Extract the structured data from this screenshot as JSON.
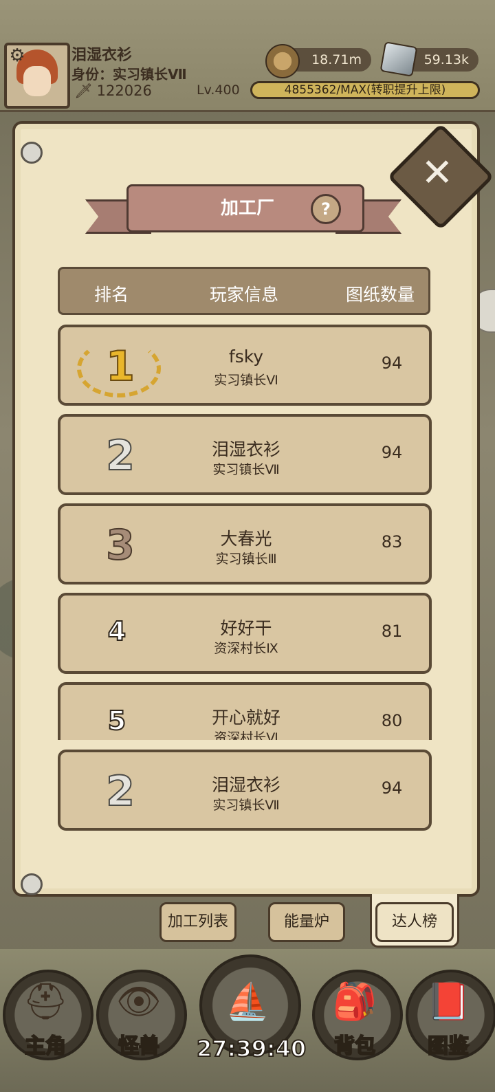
{
  "player": {
    "name": "泪湿衣衫",
    "title": "身份：实习镇长Ⅶ",
    "power": "122026",
    "level": "Lv.400",
    "exp_text": "4855362/MAX(转职提升上限)"
  },
  "resources": {
    "coins": "18.71m",
    "gems": "59.13k"
  },
  "panel": {
    "title": "加工厂",
    "headers": {
      "rank": "排名",
      "info": "玩家信息",
      "count": "图纸数量"
    }
  },
  "rankings": [
    {
      "rank": "1",
      "name": "fsky",
      "title": "实习镇长Ⅵ",
      "count": "94"
    },
    {
      "rank": "2",
      "name": "泪湿衣衫",
      "title": "实习镇长Ⅶ",
      "count": "94"
    },
    {
      "rank": "3",
      "name": "大春光",
      "title": "实习镇长Ⅲ",
      "count": "83"
    },
    {
      "rank": "4",
      "name": "好好干",
      "title": "资深村长Ⅸ",
      "count": "81"
    },
    {
      "rank": "5",
      "name": "开心就好",
      "title": "资深村长Ⅵ",
      "count": "80"
    }
  ],
  "self_rank": {
    "rank": "2",
    "name": "泪湿衣衫",
    "title": "实习镇长Ⅶ",
    "count": "94"
  },
  "tabs": [
    "加工列表",
    "能量炉",
    "达人榜"
  ],
  "bottom_nav": {
    "main": "主角",
    "monster": "怪兽",
    "timer": "27:39:40",
    "bag": "背包",
    "atlas": "图鉴"
  }
}
